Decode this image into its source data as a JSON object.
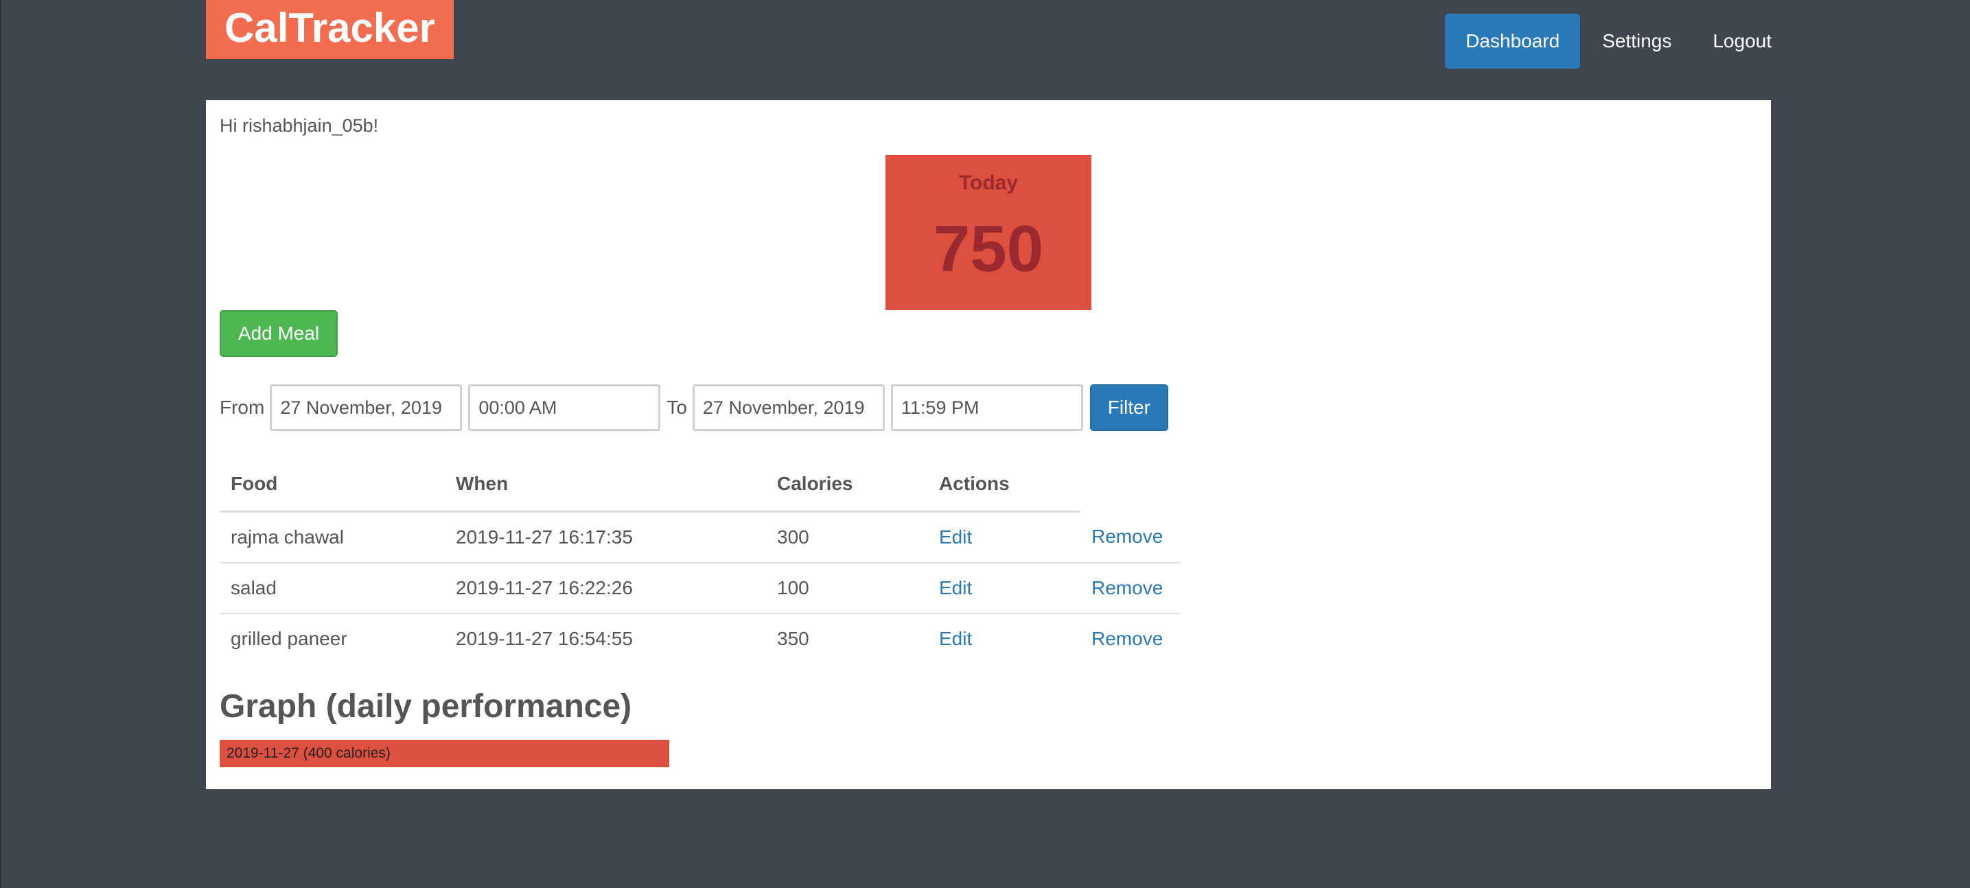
{
  "header": {
    "brand": "CalTracker",
    "nav": [
      {
        "label": "Dashboard",
        "active": true
      },
      {
        "label": "Settings",
        "active": false
      },
      {
        "label": "Logout",
        "active": false
      }
    ]
  },
  "main": {
    "greeting": "Hi rishabhjain_05b!",
    "today": {
      "label": "Today",
      "value": "750"
    },
    "add_meal_label": "Add Meal",
    "filter": {
      "from_label": "From",
      "from_date": "27 November, 2019",
      "from_time": "00:00 AM",
      "to_label": "To",
      "to_date": "27 November, 2019",
      "to_time": "11:59 PM",
      "button_label": "Filter"
    },
    "table": {
      "headers": [
        "Food",
        "When",
        "Calories",
        "Actions"
      ],
      "rows": [
        {
          "food": "rajma chawal",
          "when": "2019-11-27 16:17:35",
          "calories": "300",
          "edit": "Edit",
          "remove": "Remove"
        },
        {
          "food": "salad",
          "when": "2019-11-27 16:22:26",
          "calories": "100",
          "edit": "Edit",
          "remove": "Remove"
        },
        {
          "food": "grilled paneer",
          "when": "2019-11-27 16:54:55",
          "calories": "350",
          "edit": "Edit",
          "remove": "Remove"
        }
      ]
    },
    "graph": {
      "title": "Graph (daily performance)",
      "bars": [
        {
          "label": "2019-11-27 (400 calories)",
          "fill_percent": 54.6
        }
      ]
    }
  },
  "colors": {
    "page_background": "#3f4650",
    "brand": "#f26c50",
    "primary": "#2a7ab8",
    "success": "#4cb650",
    "danger": "#dd503f",
    "today_text": "#9b2a30"
  }
}
